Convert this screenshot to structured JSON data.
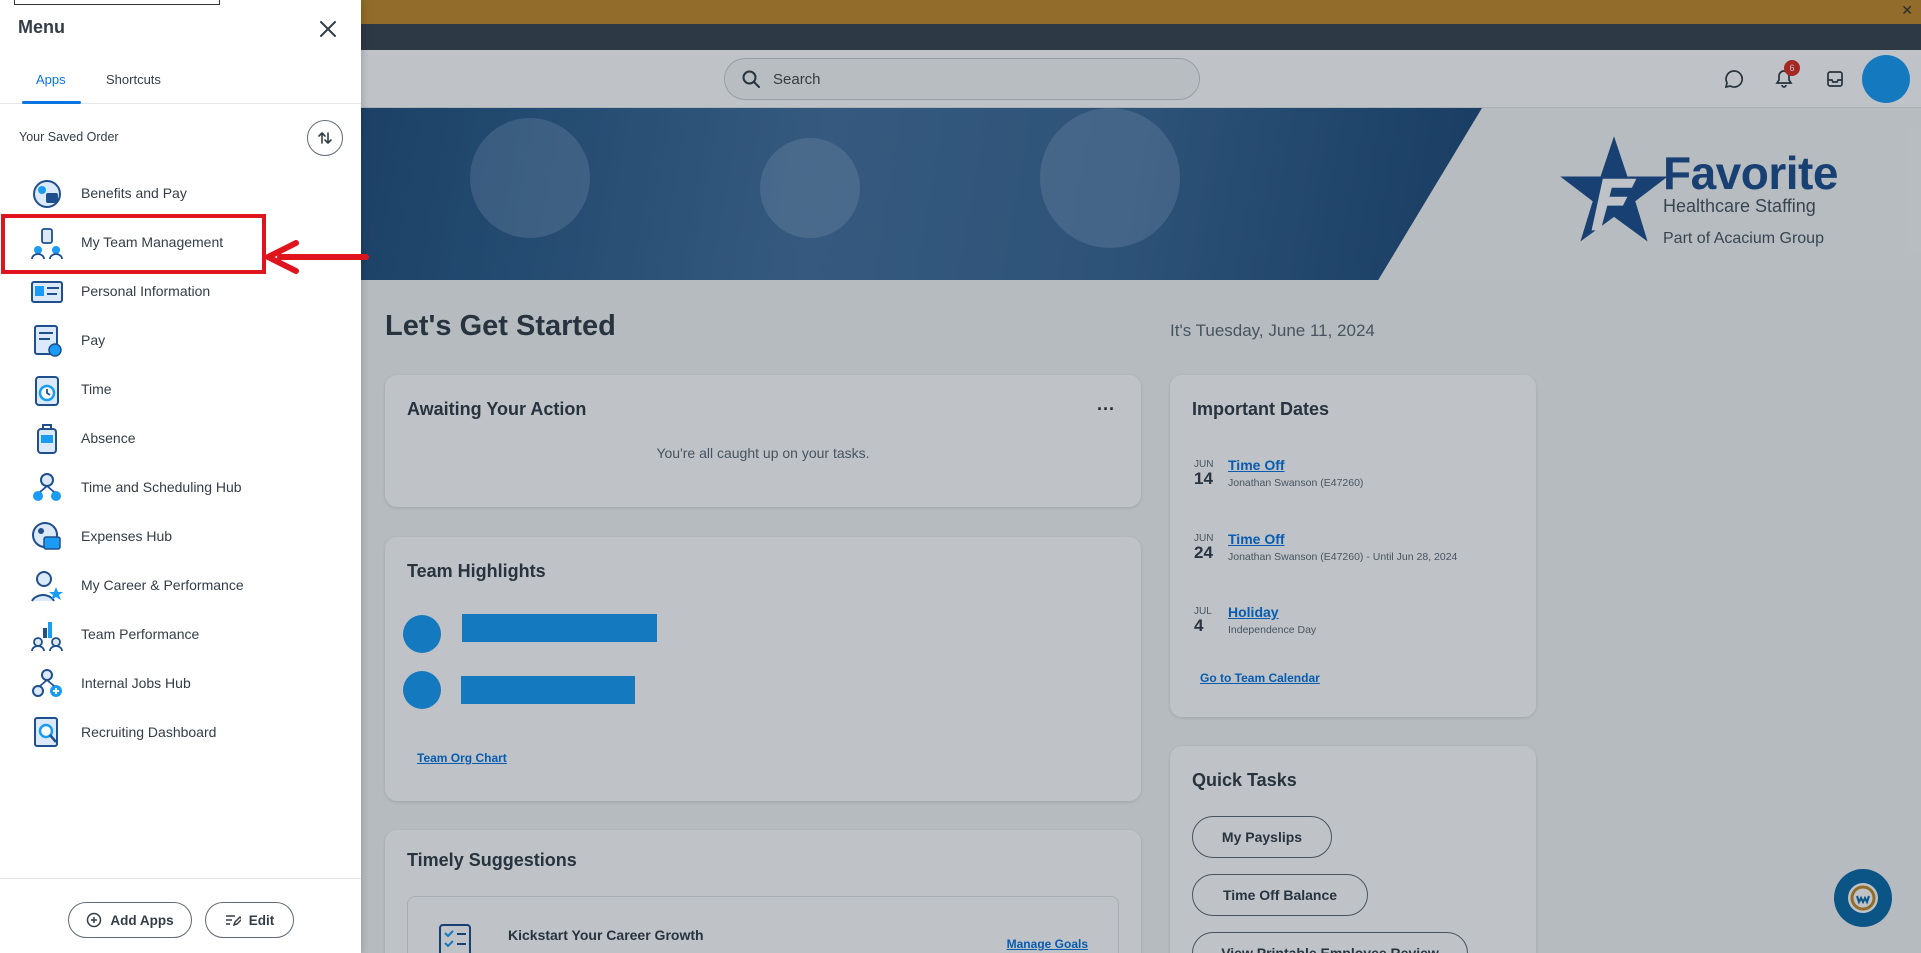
{
  "header": {
    "search_placeholder": "Search",
    "notification_count": "6"
  },
  "brand": {
    "name": "Favorite",
    "tagline": "Healthcare Staffing",
    "parent": "Part of Acacium Group"
  },
  "main": {
    "greeting": "Let's Get Started",
    "date": "It's Tuesday, June 11, 2024"
  },
  "awaiting": {
    "title": "Awaiting Your Action",
    "message": "You're all caught up on your tasks.",
    "more": "···"
  },
  "team": {
    "title": "Team Highlights",
    "org_link": "Team Org Chart"
  },
  "timely": {
    "title": "Timely Suggestions",
    "item_title": "Kickstart Your Career Growth",
    "item_link": "Manage Goals"
  },
  "dates": {
    "title": "Important Dates",
    "items": [
      {
        "month": "JUN",
        "day": "14",
        "event": "Time Off",
        "detail": "Jonathan Swanson (E47260)"
      },
      {
        "month": "JUN",
        "day": "24",
        "event": "Time Off",
        "detail": "Jonathan Swanson (E47260) - Until Jun 28, 2024"
      },
      {
        "month": "JUL",
        "day": "4",
        "event": "Holiday",
        "detail": "Independence Day"
      }
    ],
    "calendar_link": "Go to Team Calendar"
  },
  "quick": {
    "title": "Quick Tasks",
    "buttons": [
      "My Payslips",
      "Time Off Balance",
      "View Printable Employee Review"
    ]
  },
  "menu": {
    "title": "Menu",
    "tabs": [
      "Apps",
      "Shortcuts"
    ],
    "order_label": "Your Saved Order",
    "apps": [
      {
        "label": "Benefits and Pay",
        "icon": "benefits-icon"
      },
      {
        "label": "My Team Management",
        "icon": "team-management-icon"
      },
      {
        "label": "Personal Information",
        "icon": "id-card-icon"
      },
      {
        "label": "Pay",
        "icon": "pay-icon"
      },
      {
        "label": "Time",
        "icon": "clock-icon"
      },
      {
        "label": "Absence",
        "icon": "luggage-icon"
      },
      {
        "label": "Time and Scheduling Hub",
        "icon": "scheduling-hub-icon"
      },
      {
        "label": "Expenses Hub",
        "icon": "expenses-icon"
      },
      {
        "label": "My Career & Performance",
        "icon": "career-icon"
      },
      {
        "label": "Team Performance",
        "icon": "team-performance-icon"
      },
      {
        "label": "Internal Jobs Hub",
        "icon": "jobs-hub-icon"
      },
      {
        "label": "Recruiting Dashboard",
        "icon": "recruiting-icon"
      }
    ],
    "footer": {
      "add_apps": "Add Apps",
      "edit": "Edit"
    }
  },
  "colors": {
    "accent": "#0875e1",
    "highlight": "#e0141c",
    "banner": "#c18a2c",
    "redacted": "#1a9cf5"
  }
}
